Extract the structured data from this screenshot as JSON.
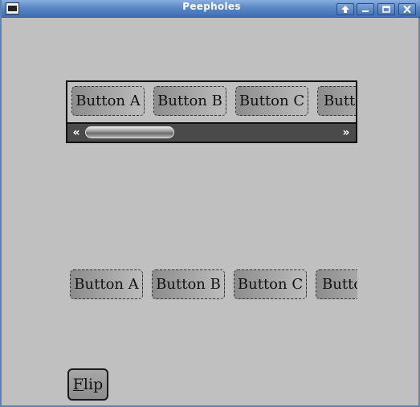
{
  "window": {
    "title": "Peepholes",
    "controls": [
      "up-arrow-icon",
      "minimize-icon",
      "maximize-icon",
      "close-icon"
    ]
  },
  "scroll_peephole": {
    "buttons": [
      "Button A",
      "Button B",
      "Button C",
      "Button D"
    ],
    "scroll_left_label": "«",
    "scroll_right_label": "»"
  },
  "static_peephole": {
    "buttons": [
      "Button A",
      "Button B",
      "Button C",
      "Button D"
    ]
  },
  "flip_button": {
    "mnemonic": "F",
    "rest": "lip"
  },
  "colors": {
    "titlebar": "#5b88c6",
    "background": "#c0c0c0",
    "scrollbar": "#4a4a4a"
  }
}
